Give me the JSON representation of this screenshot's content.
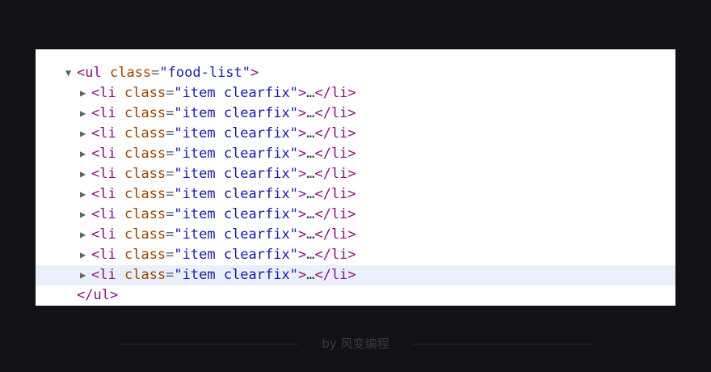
{
  "elements": {
    "root_open": {
      "lt": "<",
      "tag": "ul",
      "attr_name": "class",
      "eq": "=",
      "attr_value": "\"food-list\"",
      "gt": ">"
    },
    "child_row": {
      "lt": "<",
      "tag": "li",
      "attr_name": "class",
      "eq": "=",
      "attr_value": "\"item clearfix\"",
      "gt": ">",
      "ellipsis": "…",
      "close_lt": "</",
      "close_tag": "li",
      "close_gt": ">"
    },
    "child_count": 10,
    "selected_index": 9,
    "root_close": {
      "lt": "</",
      "tag": "ul",
      "gt": ">"
    }
  },
  "icons": {
    "expanded": "triangle-down-icon",
    "collapsed": "triangle-right-icon"
  },
  "footer": {
    "text": "by 风变编程"
  },
  "colors": {
    "tag": "#881280",
    "attr_name": "#994500",
    "attr_value": "#1a1aa6",
    "selected_row": "#e9f0fb",
    "background": "#111116"
  }
}
